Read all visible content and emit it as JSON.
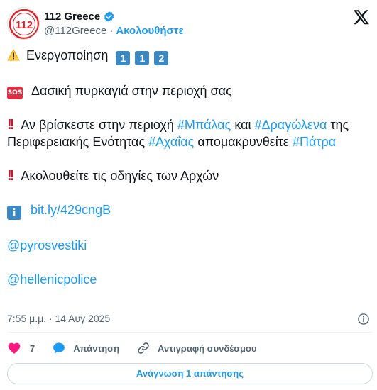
{
  "colors": {
    "accent": "#1d9bf0",
    "text": "#0f1419",
    "muted": "#536471",
    "like": "#f91880",
    "avatar_red": "#e0232b"
  },
  "account": {
    "display_name": "112 Greece",
    "handle": "@112Greece",
    "separator": "·",
    "follow_label": "Ακολουθήστε",
    "avatar_text": "112",
    "verified_icon": "verified-badge-icon"
  },
  "tweet": {
    "line1_text": "Ενεργοποίηση",
    "line1_keys": [
      "1",
      "1",
      "2"
    ],
    "line2_badge": "SOS",
    "line2_text": "Δασική πυρκαγιά στην περιοχή σας",
    "line3_bang": "!!",
    "line3_a": "Αν βρίσκεστε στην περιοχή",
    "tag_balas": "#Μπάλας",
    "line3_b": "και",
    "tag_dragolena": "#Δραγώλενα",
    "line3_c": "της Περιφερειακής Ενότητας",
    "tag_achaia": "#Αχαΐας",
    "line3_d": "απομακρυνθείτε",
    "tag_patra": "#Πάτρα",
    "line4_bang": "!!",
    "line4_text": "Ακολουθείτε τις οδηγίες των Αρχών",
    "line5_info": "i",
    "link_bitly": "bit.ly/429cngB",
    "mention1": "@pyrosvestiki",
    "mention2": "@hellenicpolice"
  },
  "meta": {
    "timestamp": "7:55 μ.μ. · 14 Αυγ 2025"
  },
  "actions": {
    "like_count": "7",
    "reply_label": "Απάντηση",
    "copy_label": "Αντιγραφή συνδέσμου"
  },
  "read_reply_label": "Ανάγνωση 1 απάντησης"
}
